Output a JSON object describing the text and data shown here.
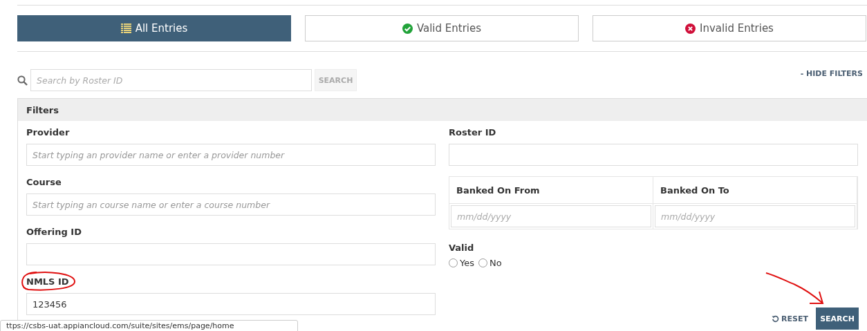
{
  "tabs": [
    {
      "label": "All Entries",
      "kind": "all",
      "selected": true
    },
    {
      "label": "Valid Entries",
      "kind": "valid",
      "selected": false
    },
    {
      "label": "Invalid Entries",
      "kind": "invalid",
      "selected": false
    }
  ],
  "search": {
    "placeholder": "Search by Roster ID",
    "button": "SEARCH"
  },
  "hide_filters": "- HIDE FILTERS",
  "filters": {
    "title": "Filters",
    "left_fields": [
      {
        "label": "Provider",
        "placeholder": "Start typing an provider name or enter a provider number"
      },
      {
        "label": "Course",
        "placeholder": "Start typing an course name or enter a course number"
      },
      {
        "label": "Offering ID"
      },
      {
        "label": "NMLS ID",
        "value": "123456",
        "circled": true
      }
    ],
    "roster": {
      "label": "Roster ID"
    },
    "date_range": [
      {
        "label": "Banked On From",
        "placeholder": "mm/dd/yyyy"
      },
      {
        "label": "Banked On To",
        "placeholder": "mm/dd/yyyy"
      }
    ],
    "valid": {
      "label": "Valid",
      "options": [
        {
          "label": "Yes",
          "selected": false
        },
        {
          "label": "No",
          "selected": false
        }
      ]
    }
  },
  "actions": {
    "reset": "RESET",
    "search": "SEARCH"
  },
  "status_url": "ttps://csbs-uat.appiancloud.com/suite/sites/ems/page/home"
}
